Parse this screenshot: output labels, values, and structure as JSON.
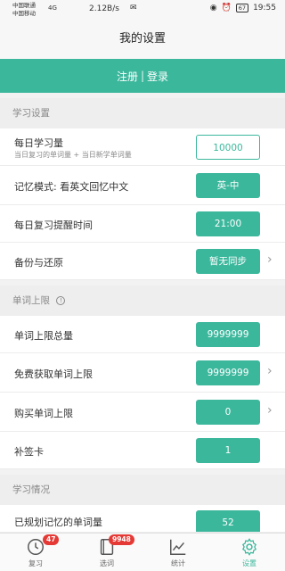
{
  "status_bar": {
    "carrier_1": "中国联通",
    "carrier_2": "中国移动",
    "signal": "4G",
    "network_speed": "2.12B/s",
    "battery": "67",
    "time": "19:55"
  },
  "title": "我的设置",
  "banner": {
    "register": "注册",
    "separator": "|",
    "login": "登录"
  },
  "sections": {
    "study_settings": "学习设置",
    "word_limit": "单词上限",
    "study_status": "学习情况"
  },
  "rows": {
    "daily_study": {
      "label": "每日学习量",
      "sublabel": "当日复习的单词量 + 当日新学单词量",
      "value": "10000"
    },
    "memory_mode": {
      "label": "记忆模式: 看英文回忆中文",
      "value": "英-中"
    },
    "reminder": {
      "label": "每日复习提醒时间",
      "value": "21:00"
    },
    "backup": {
      "label": "备份与还原",
      "value": "暂无同步"
    },
    "total_limit": {
      "label": "单词上限总量",
      "value": "9999999"
    },
    "free_limit": {
      "label": "免费获取单词上限",
      "value": "9999999"
    },
    "buy_limit": {
      "label": "购买单词上限",
      "value": "0"
    },
    "makeup_card": {
      "label": "补签卡",
      "value": "1"
    },
    "planned_words": {
      "label": "已规划记忆的单词量",
      "value": "52"
    }
  },
  "tabs": [
    {
      "label": "复习",
      "badge": "47",
      "icon": "clock-icon"
    },
    {
      "label": "选词",
      "badge": "9948",
      "icon": "book-icon"
    },
    {
      "label": "统计",
      "badge": "",
      "icon": "chart-icon"
    },
    {
      "label": "设置",
      "badge": "",
      "icon": "gear-icon"
    }
  ],
  "colors": {
    "accent": "#3bb79c",
    "badge": "#e53935"
  }
}
